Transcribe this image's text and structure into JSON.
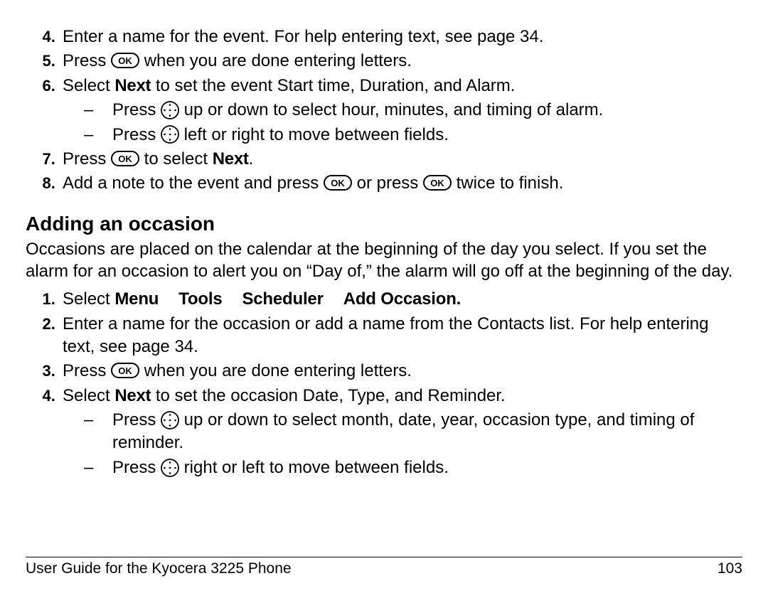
{
  "list1": {
    "start": 4,
    "items": [
      "Enter a name for the event. For help entering text, see page 34.",
      "Press [OK] when you are done entering letters.",
      "Select [B]Next[/B] to set the event Start time, Duration, and Alarm.",
      "Press [OK] to select [B]Next[/B].",
      "Add a note to the event and press [OK] or press [OK] twice to finish."
    ],
    "sub6": [
      "Press [NAV] up or down to select hour, minutes, and timing of alarm.",
      "Press [NAV] left or right to move between fields."
    ]
  },
  "heading": "Adding an occasion",
  "para": "Occasions are placed on the calendar at the beginning of the day you select. If you set the alarm for an occasion to alert you on “Day of,” the alarm will go off at the beginning of the day.",
  "list2": {
    "start": 1,
    "menupath": [
      "Menu",
      "Tools",
      "Scheduler",
      "Add Occasion."
    ],
    "item1_prefix": "Select ",
    "items": [
      "",
      "Enter a name for the occasion or add a name from the Contacts list. For help entering text, see page 34.",
      "Press [OK] when you are done entering letters.",
      "Select [B]Next[/B] to set the occasion Date, Type, and Reminder."
    ],
    "sub4": [
      "Press [NAV] up or down to select month, date, year, occasion type, and timing of reminder.",
      "Press [NAV] right or left to move between fields."
    ]
  },
  "footer": {
    "left": "User Guide for the Kyocera 3225 Phone",
    "right": "103"
  },
  "icons": {
    "ok_label": "OK"
  }
}
